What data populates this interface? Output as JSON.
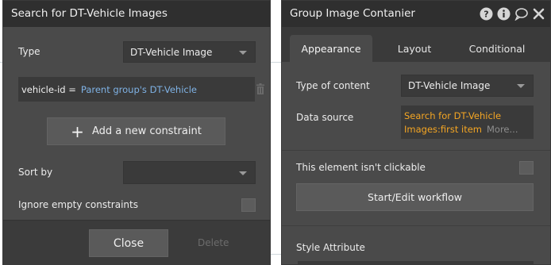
{
  "left_panel": {
    "title": "Search for DT-Vehicle Images",
    "type_label": "Type",
    "type_value": "DT-Vehicle Image",
    "constraint": {
      "key": "vehicle-id =",
      "value": "Parent group's DT-Vehicle"
    },
    "add_constraint_label": "Add a new constraint",
    "sort_by_label": "Sort by",
    "sort_by_value": "",
    "ignore_empty_label": "Ignore empty constraints",
    "close_label": "Close",
    "delete_label": "Delete"
  },
  "right_panel": {
    "title": "Group Image Contanier",
    "icons": [
      "help-icon",
      "info-icon",
      "comment-icon",
      "close-icon"
    ],
    "tabs": [
      {
        "label": "Appearance",
        "active": true
      },
      {
        "label": "Layout",
        "active": false
      },
      {
        "label": "Conditional",
        "active": false
      }
    ],
    "type_of_content_label": "Type of content",
    "type_of_content_value": "DT-Vehicle Image",
    "data_source_label": "Data source",
    "data_source_value": "Search for DT-Vehicle Images:first item",
    "data_source_more": "More...",
    "not_clickable_label": "This element isn't clickable",
    "workflow_button_label": "Start/Edit workflow",
    "style_attribute_label": "Style Attribute"
  },
  "colors": {
    "panel_bg": "#4a4a4a",
    "titlebar_bg": "#2f2f2f",
    "field_bg": "#3a3a3a",
    "link_blue": "#7fb2e5",
    "expression_orange": "#f5a623"
  }
}
